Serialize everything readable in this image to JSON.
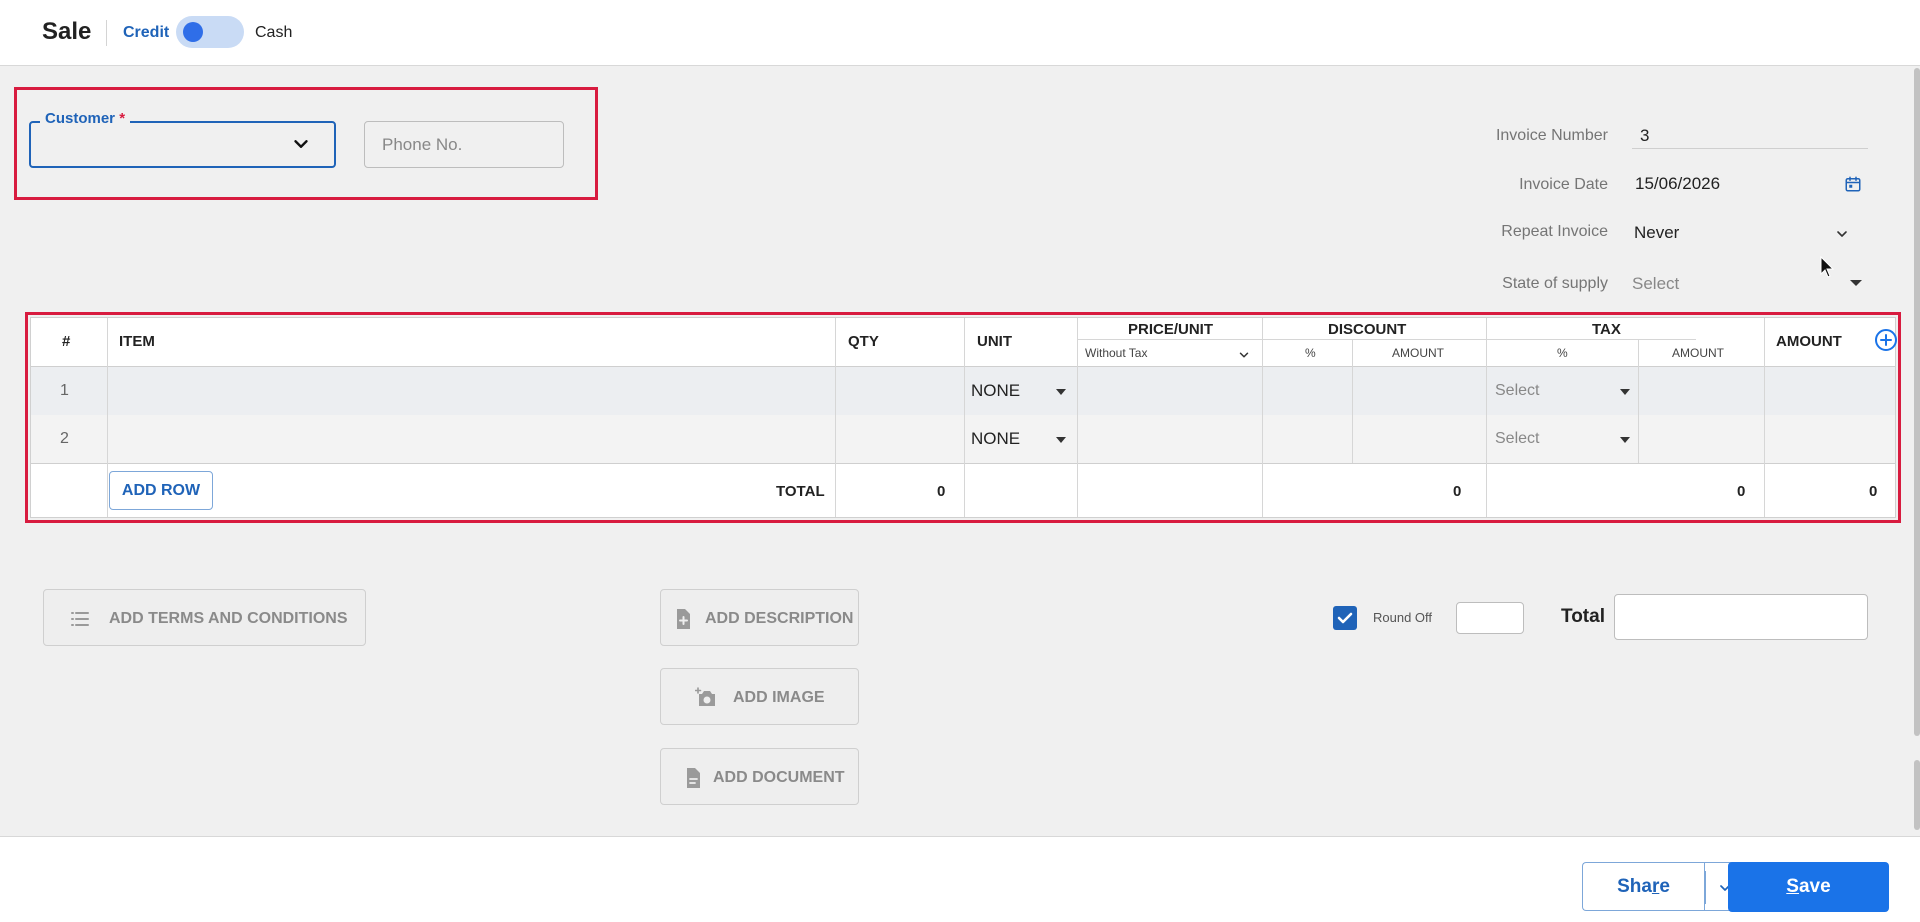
{
  "header": {
    "title": "Sale",
    "credit_label": "Credit",
    "cash_label": "Cash"
  },
  "customer": {
    "label": "Customer",
    "required_mark": "*",
    "phone_placeholder": "Phone No."
  },
  "invoice": {
    "number_label": "Invoice Number",
    "number_value": "3",
    "date_label": "Invoice Date",
    "date_value": "15/06/2026",
    "repeat_label": "Repeat Invoice",
    "repeat_value": "Never",
    "state_label": "State of supply",
    "state_value": "Select"
  },
  "table": {
    "headers": {
      "num": "#",
      "item": "ITEM",
      "qty": "QTY",
      "unit": "UNIT",
      "price_unit": "PRICE/UNIT",
      "price_sub": "Without Tax",
      "discount": "DISCOUNT",
      "discount_pct": "%",
      "discount_amount": "AMOUNT",
      "tax": "TAX",
      "tax_pct": "%",
      "tax_amount": "AMOUNT",
      "amount": "AMOUNT"
    },
    "rows": [
      {
        "num": "1",
        "unit": "NONE",
        "tax": "Select"
      },
      {
        "num": "2",
        "unit": "NONE",
        "tax": "Select"
      }
    ],
    "add_row_label": "ADD ROW",
    "total_label": "TOTAL",
    "totals": {
      "qty": "0",
      "discount": "0",
      "tax": "0",
      "amount": "0"
    }
  },
  "actions": {
    "terms": "ADD TERMS AND CONDITIONS",
    "description": "ADD DESCRIPTION",
    "image": "ADD IMAGE",
    "document": "ADD DOCUMENT"
  },
  "summary": {
    "round_off_label": "Round Off",
    "total_label": "Total"
  },
  "footer": {
    "share_pre": "Sha",
    "share_u": "r",
    "share_post": "e",
    "save_u": "S",
    "save_post": "ave"
  },
  "colors": {
    "accent": "#1a73e8",
    "highlight": "#d81b3f",
    "link": "#1f63b8"
  }
}
